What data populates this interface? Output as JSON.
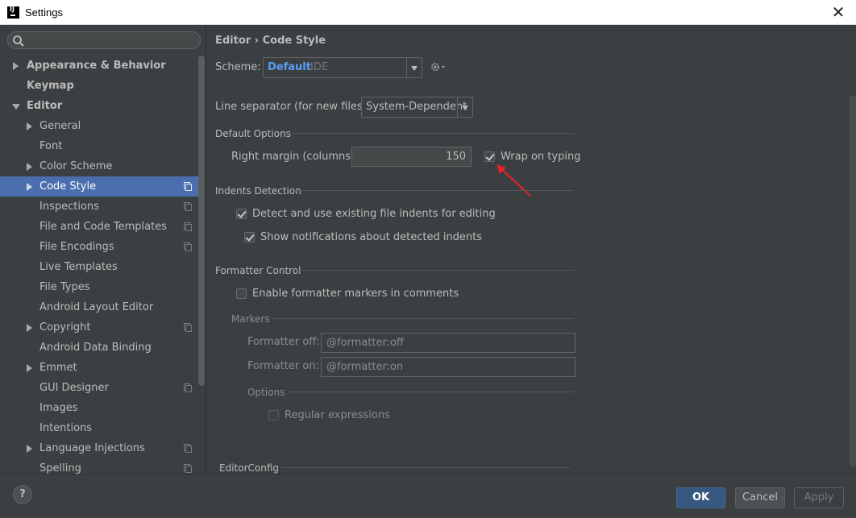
{
  "window": {
    "title": "Settings",
    "close": "✕"
  },
  "search": {
    "placeholder": ""
  },
  "sidebar": {
    "items": [
      {
        "label": "Appearance & Behavior"
      },
      {
        "label": "Keymap"
      },
      {
        "label": "Editor"
      },
      {
        "label": "General"
      },
      {
        "label": "Font"
      },
      {
        "label": "Color Scheme"
      },
      {
        "label": "Code Style"
      },
      {
        "label": "Inspections"
      },
      {
        "label": "File and Code Templates"
      },
      {
        "label": "File Encodings"
      },
      {
        "label": "Live Templates"
      },
      {
        "label": "File Types"
      },
      {
        "label": "Android Layout Editor"
      },
      {
        "label": "Copyright"
      },
      {
        "label": "Android Data Binding"
      },
      {
        "label": "Emmet"
      },
      {
        "label": "GUI Designer"
      },
      {
        "label": "Images"
      },
      {
        "label": "Intentions"
      },
      {
        "label": "Language Injections"
      },
      {
        "label": "Spelling"
      }
    ]
  },
  "main": {
    "breadcrumb": "Editor › Code Style",
    "scheme": {
      "label": "Scheme:",
      "name": "Default",
      "scope": "IDE"
    },
    "line_separator": {
      "label": "Line separator (for new files):",
      "value": "System-Dependent"
    },
    "default_options": {
      "title": "Default Options",
      "right_margin_label": "Right margin (columns):",
      "right_margin_value": "150",
      "wrap_on_typing": "Wrap on typing"
    },
    "indents": {
      "title": "Indents Detection",
      "detect": "Detect and use existing file indents for editing",
      "notify": "Show notifications about detected indents"
    },
    "formatter": {
      "title": "Formatter Control",
      "enable_markers": "Enable formatter markers in comments",
      "markers_title": "Markers",
      "off_label": "Formatter off:",
      "off_value": "@formatter:off",
      "on_label": "Formatter on:",
      "on_value": "@formatter:on",
      "options_title": "Options",
      "regex": "Regular expressions"
    },
    "editorconfig_title": "EditorConfig"
  },
  "buttons": {
    "help": "?",
    "ok": "OK",
    "cancel": "Cancel",
    "apply": "Apply"
  },
  "colors": {
    "accent": "#4b6eaf",
    "scheme_name": "#589df6",
    "annotation_arrow": "#e3242b"
  }
}
